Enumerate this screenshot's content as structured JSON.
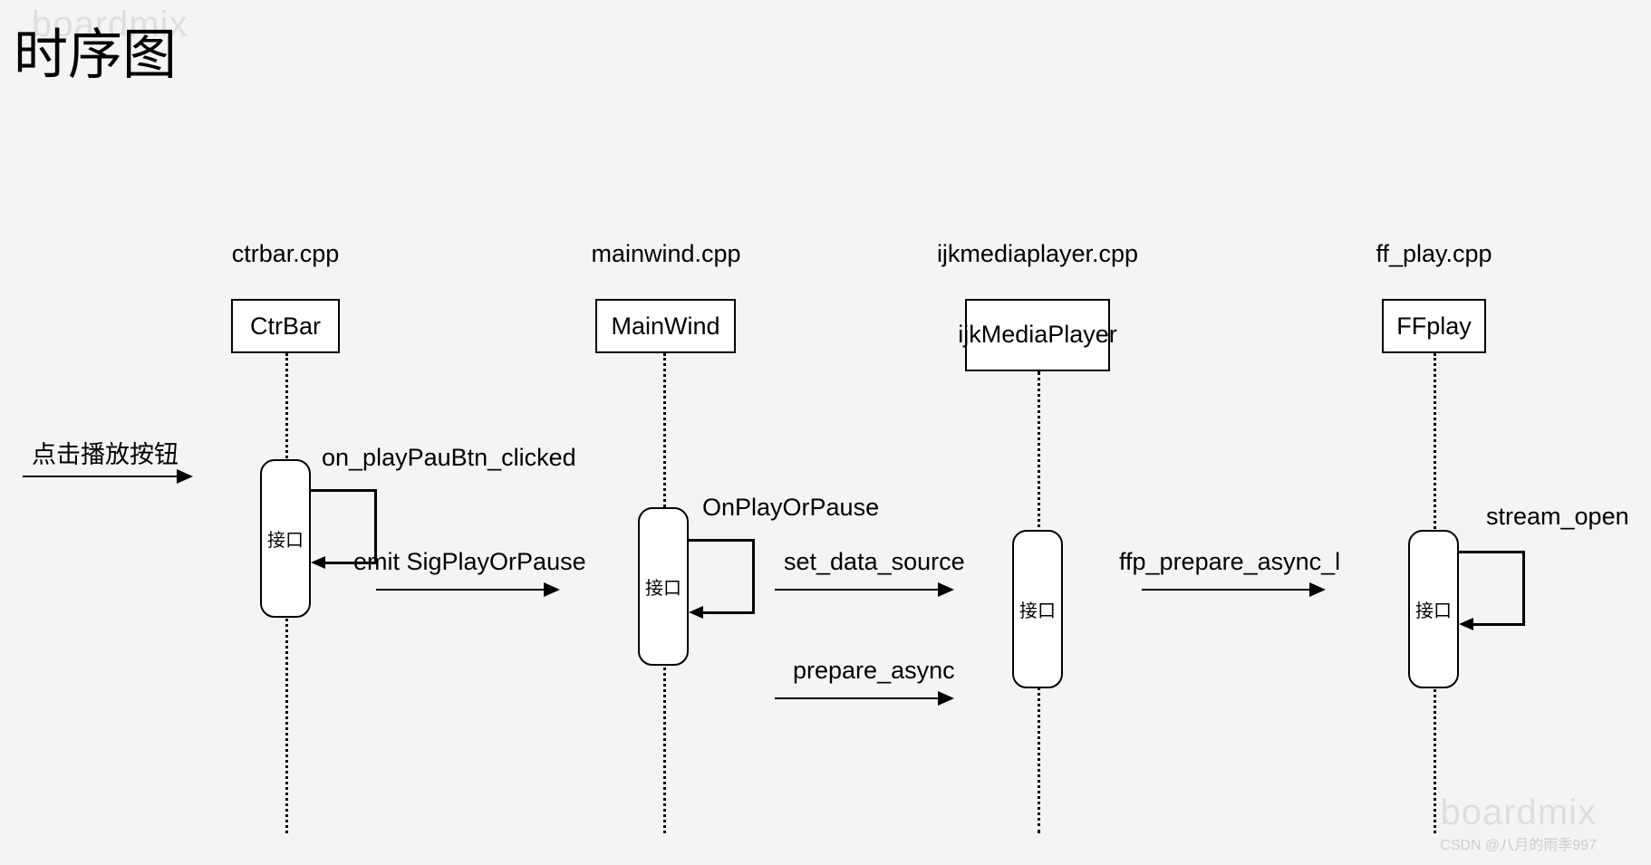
{
  "title": "时序图",
  "watermark": "boardmix",
  "credit": "CSDN @八月的雨季997",
  "participants": {
    "ctrbar": {
      "file": "ctrbar.cpp",
      "name": "CtrBar"
    },
    "mainwind": {
      "file": "mainwind.cpp",
      "name": "MainWind"
    },
    "ijk": {
      "file": "ijkmediaplayer.cpp",
      "name": "ijkMediaPlayer"
    },
    "ffplay": {
      "file": "ff_play.cpp",
      "name": "FFplay"
    }
  },
  "trigger_label": "点击播放按钮",
  "activation_label": "接口",
  "messages": {
    "on_play_btn": "on_playPauBtn_clicked",
    "sig_play_pause": "emit SigPlayOrPause",
    "on_play_or_pause": "OnPlayOrPause",
    "set_data_source": "set_data_source",
    "prepare_async": "prepare_async",
    "ffp_prepare": "ffp_prepare_async_l",
    "stream_open": "stream_open"
  }
}
